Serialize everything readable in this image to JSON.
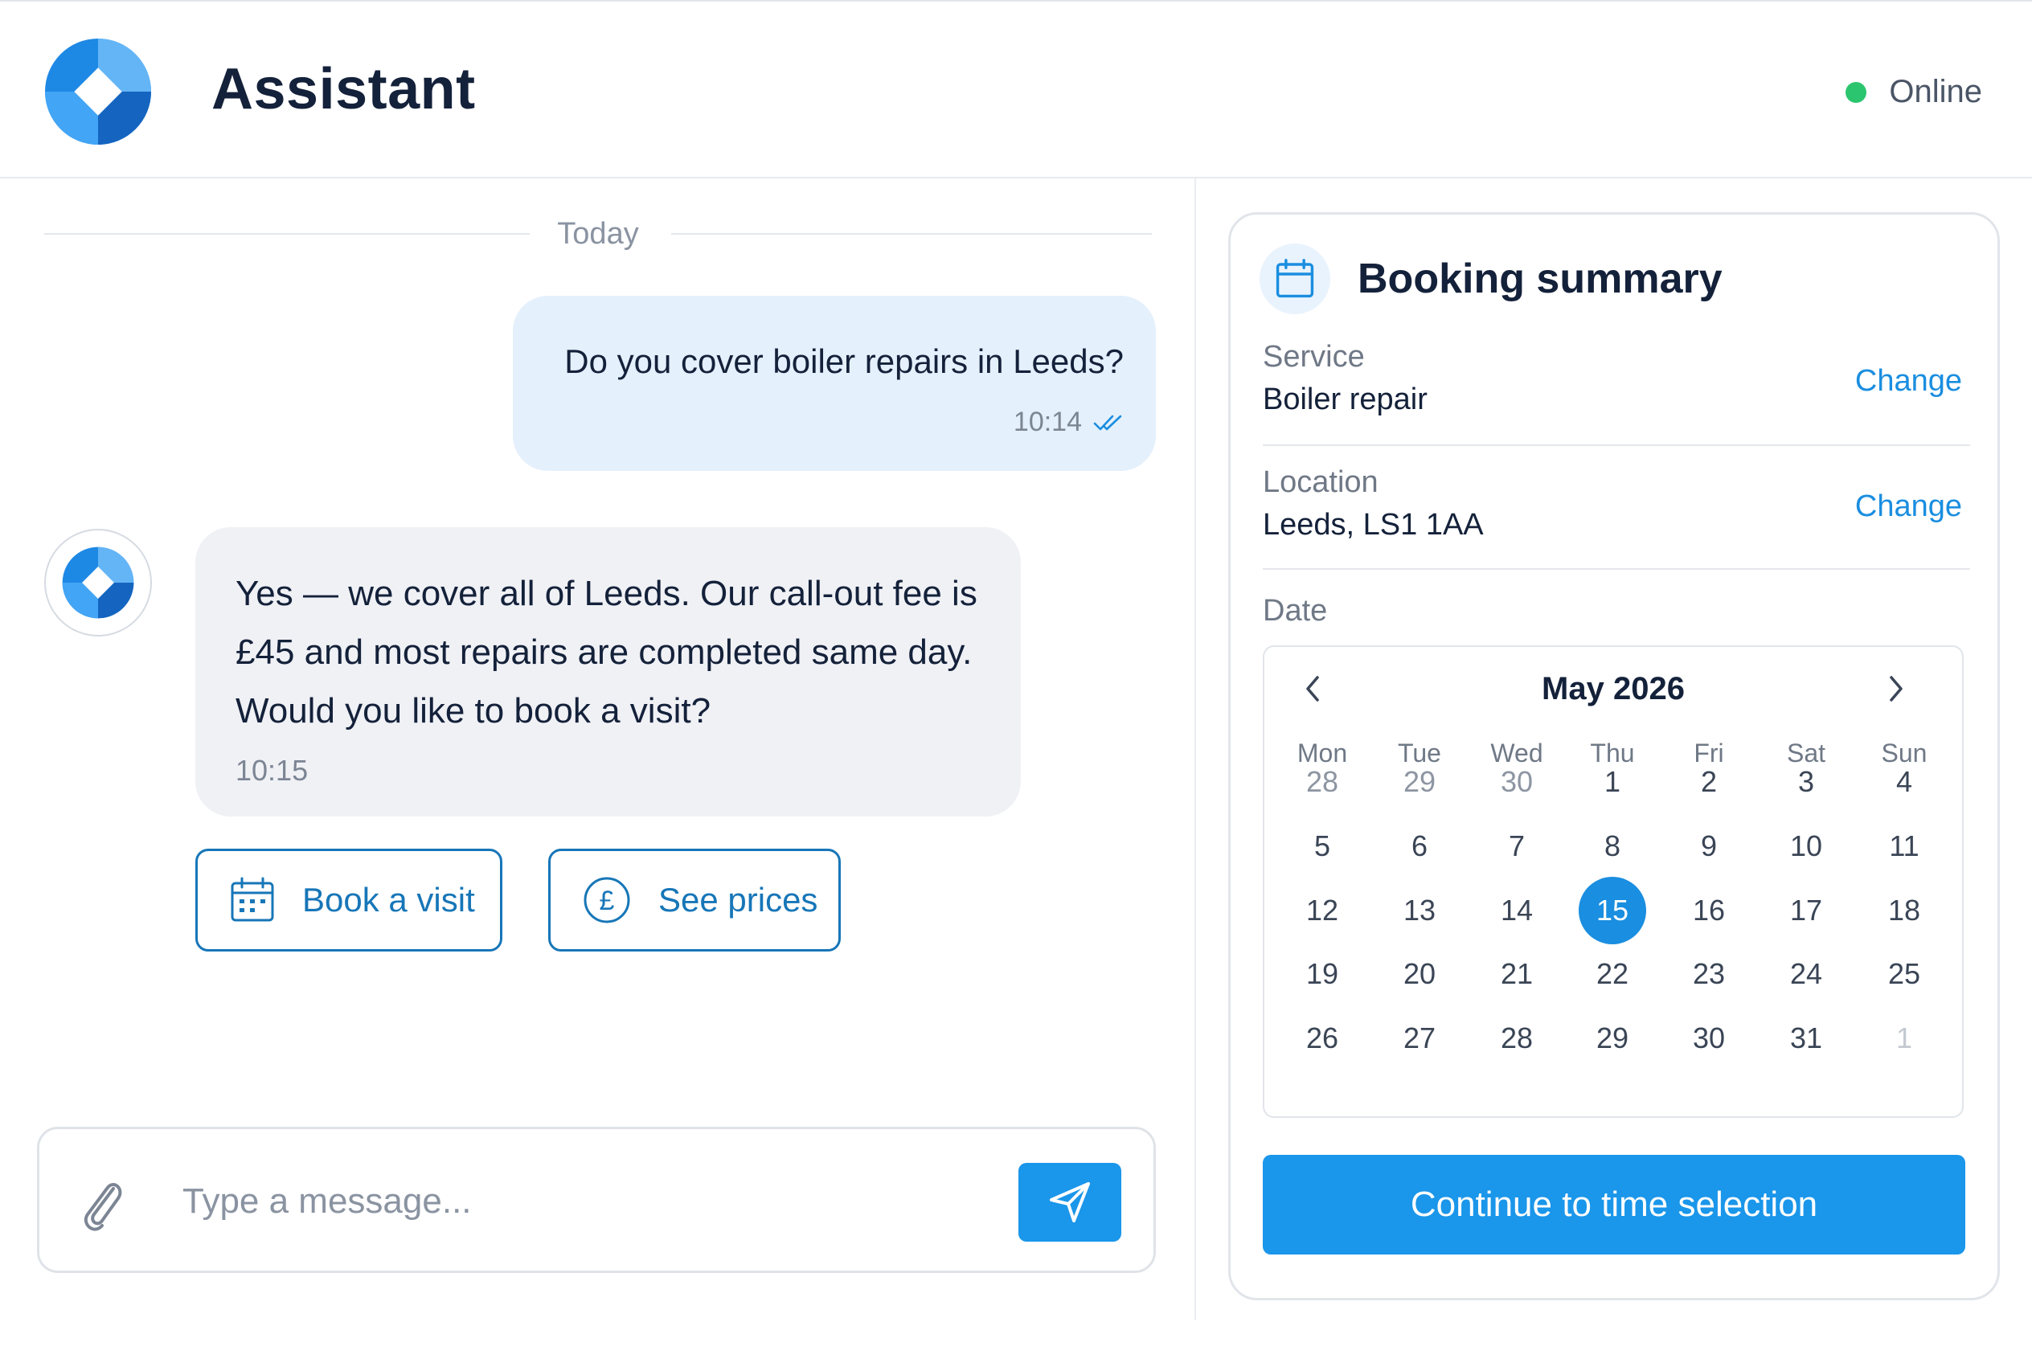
{
  "header": {
    "title": "Assistant",
    "status_text": "Online",
    "status_color": "#2cc56f",
    "logo_icon": "assistant-logo-icon"
  },
  "chat": {
    "day_separator": "Today",
    "messages": [
      {
        "from": "user",
        "text": "Do you cover boiler repairs in Leeds?",
        "time": "10:14",
        "read_icon": "double-check-icon"
      },
      {
        "from": "assistant",
        "text": "Yes — we cover all of Leeds. Our call-out fee is £45 and most repairs are completed same day. Would you like to book a visit?",
        "time": "10:15"
      }
    ],
    "quick_replies": [
      {
        "label": "Book a visit",
        "icon": "calendar-icon"
      },
      {
        "label": "See prices",
        "icon": "pound-icon"
      }
    ],
    "composer": {
      "placeholder": "Type a message...",
      "value": "",
      "attach_icon": "paperclip-icon",
      "send_icon": "send-icon"
    }
  },
  "booking": {
    "title": "Booking summary",
    "service_label": "Service",
    "service_value": "Boiler repair",
    "location_label": "Location",
    "location_value": "Leeds, LS1 1AA",
    "change_label": "Change",
    "date_label": "Date",
    "calendar": {
      "month": "May 2026",
      "weekdays": [
        "Mon",
        "Tue",
        "Wed",
        "Thu",
        "Fri",
        "Sat",
        "Sun"
      ],
      "weeks": [
        [
          "28",
          "29",
          "30",
          "1",
          "2",
          "3",
          "4"
        ],
        [
          "5",
          "6",
          "7",
          "8",
          "9",
          "10",
          "11"
        ],
        [
          "12",
          "13",
          "14",
          "15",
          "16",
          "17",
          "18"
        ],
        [
          "19",
          "20",
          "21",
          "22",
          "23",
          "24",
          "25"
        ],
        [
          "26",
          "27",
          "28",
          "29",
          "30",
          "31",
          "1"
        ]
      ],
      "selected": "15"
    },
    "cta_label": "Continue to time selection"
  },
  "colors": {
    "accent": "#1a96ea",
    "user_bubble": "#e4f0fc",
    "bot_bubble": "#f0f1f5",
    "button_outline": "#1776b8"
  }
}
